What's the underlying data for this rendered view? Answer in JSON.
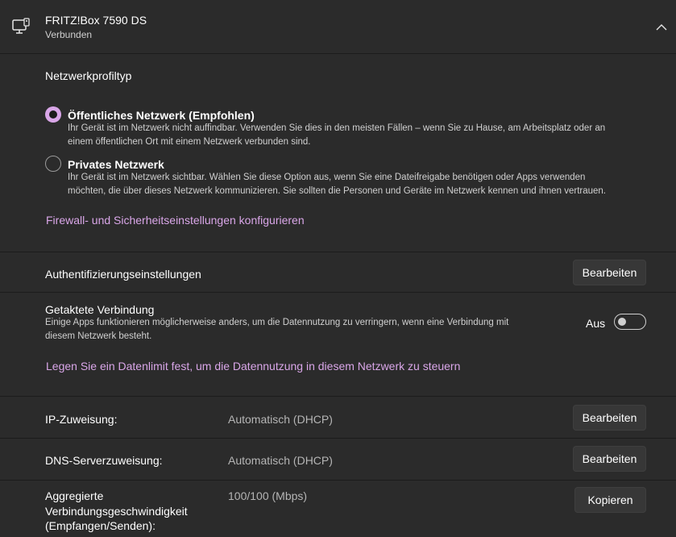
{
  "header": {
    "device_name": "FRITZ!Box 7590 DS",
    "status": "Verbunden",
    "device_icon": "computer-network-icon",
    "collapse_icon": "chevron-up-icon"
  },
  "network_profile": {
    "heading": "Netzwerkprofiltyp",
    "options": [
      {
        "label": "Öffentliches Netzwerk (Empfohlen)",
        "description_line1": "Ihr Gerät ist im Netzwerk nicht auffindbar. Verwenden Sie dies in den meisten Fällen – wenn Sie zu Hause, am Arbeitsplatz oder an",
        "description_line2": "einem öffentlichen Ort mit einem Netzwerk verbunden sind.",
        "selected": true
      },
      {
        "label": "Privates Netzwerk",
        "description_line1": "Ihr Gerät ist im Netzwerk sichtbar. Wählen Sie diese Option aus, wenn Sie eine Dateifreigabe benötigen oder Apps verwenden",
        "description_line2": "möchten, die über dieses Netzwerk kommunizieren. Sie sollten die Personen und Geräte im Netzwerk kennen und ihnen vertrauen.",
        "selected": false
      }
    ],
    "firewall_link": "Firewall- und Sicherheitseinstellungen konfigurieren"
  },
  "auth": {
    "label": "Authentifizierungseinstellungen",
    "button": "Bearbeiten"
  },
  "metered": {
    "label": "Getaktete Verbindung",
    "description_line1": "Einige Apps funktionieren möglicherweise anders, um die Datennutzung zu verringern, wenn eine Verbindung mit",
    "description_line2": "diesem Netzwerk besteht.",
    "toggle_state": "Aus",
    "toggle_on": false,
    "data_limit_link": "Legen Sie ein Datenlimit fest, um die Datennutzung in diesem Netzwerk zu steuern"
  },
  "ip": {
    "label": "IP-Zuweisung:",
    "value": "Automatisch (DHCP)",
    "button": "Bearbeiten"
  },
  "dns": {
    "label": "DNS-Serverzuweisung:",
    "value": "Automatisch (DHCP)",
    "button": "Bearbeiten"
  },
  "speed": {
    "label_line1": "Aggregierte",
    "label_line2": "Verbindungsgeschwindigkeit",
    "label_line3": "(Empfangen/Senden):",
    "value": "100/100 (Mbps)",
    "button": "Kopieren"
  },
  "colors": {
    "accent": "#d9a6e8",
    "card_bg": "#2b2b2b",
    "page_bg": "#202020"
  }
}
